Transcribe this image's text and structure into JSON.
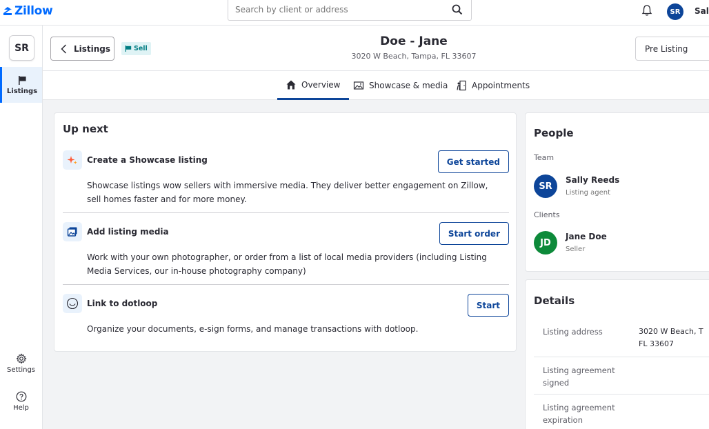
{
  "topbar": {
    "logo": "Zillow",
    "search_placeholder": "Search by client or address",
    "avatar_initials": "SR",
    "user_name": "Sally"
  },
  "rail": {
    "avatar_initials": "SR",
    "items": [
      {
        "label": "Listings",
        "icon": "flag-icon"
      }
    ],
    "settings_label": "Settings",
    "help_label": "Help"
  },
  "header": {
    "back_label": "Listings",
    "badge": "Sell",
    "title": "Doe - Jane",
    "address": "3020 W Beach, Tampa, FL 33607",
    "status": "Pre Listing"
  },
  "tabs": [
    {
      "label": "Overview",
      "icon": "home-icon",
      "active": true
    },
    {
      "label": "Showcase & media",
      "icon": "image-icon",
      "active": false
    },
    {
      "label": "Appointments",
      "icon": "door-icon",
      "active": false
    }
  ],
  "upnext": {
    "heading": "Up next",
    "tasks": [
      {
        "title": "Create a Showcase listing",
        "description": "Showcase listings wow sellers with immersive media. They deliver better engagement on Zillow, sell homes faster and for more money.",
        "button": "Get started",
        "icon": "sparkle-icon"
      },
      {
        "title": "Add listing media",
        "description": "Work with your own photographer, or order from a list of local media providers (including Listing Media Services, our in-house photography company)",
        "button": "Start order",
        "icon": "photo-icon"
      },
      {
        "title": "Link to dotloop",
        "description": "Organize your documents, e-sign forms, and manage transactions with dotloop.",
        "button": "Start",
        "icon": "dotloop-icon"
      }
    ]
  },
  "people": {
    "heading": "People",
    "team_label": "Team",
    "team": [
      {
        "initials": "SR",
        "name": "Sally Reeds",
        "role": "Listing agent",
        "color": "#0d4599"
      }
    ],
    "clients_label": "Clients",
    "clients": [
      {
        "initials": "JD",
        "name": "Jane Doe",
        "role": "Seller",
        "color": "#0d8a3a"
      }
    ]
  },
  "details": {
    "heading": "Details",
    "rows": [
      {
        "label": "Listing address",
        "value": "3020 W Beach, T",
        "value2": "FL 33607"
      },
      {
        "label": "Listing agreement signed",
        "value": "",
        "value2": ""
      },
      {
        "label": "Listing agreement expiration",
        "value": "",
        "value2": ""
      }
    ]
  },
  "colors": {
    "accent": "#006aff",
    "brand_dark": "#0d4599",
    "client_green": "#0d8a3a",
    "badge_teal": "#007d83"
  }
}
